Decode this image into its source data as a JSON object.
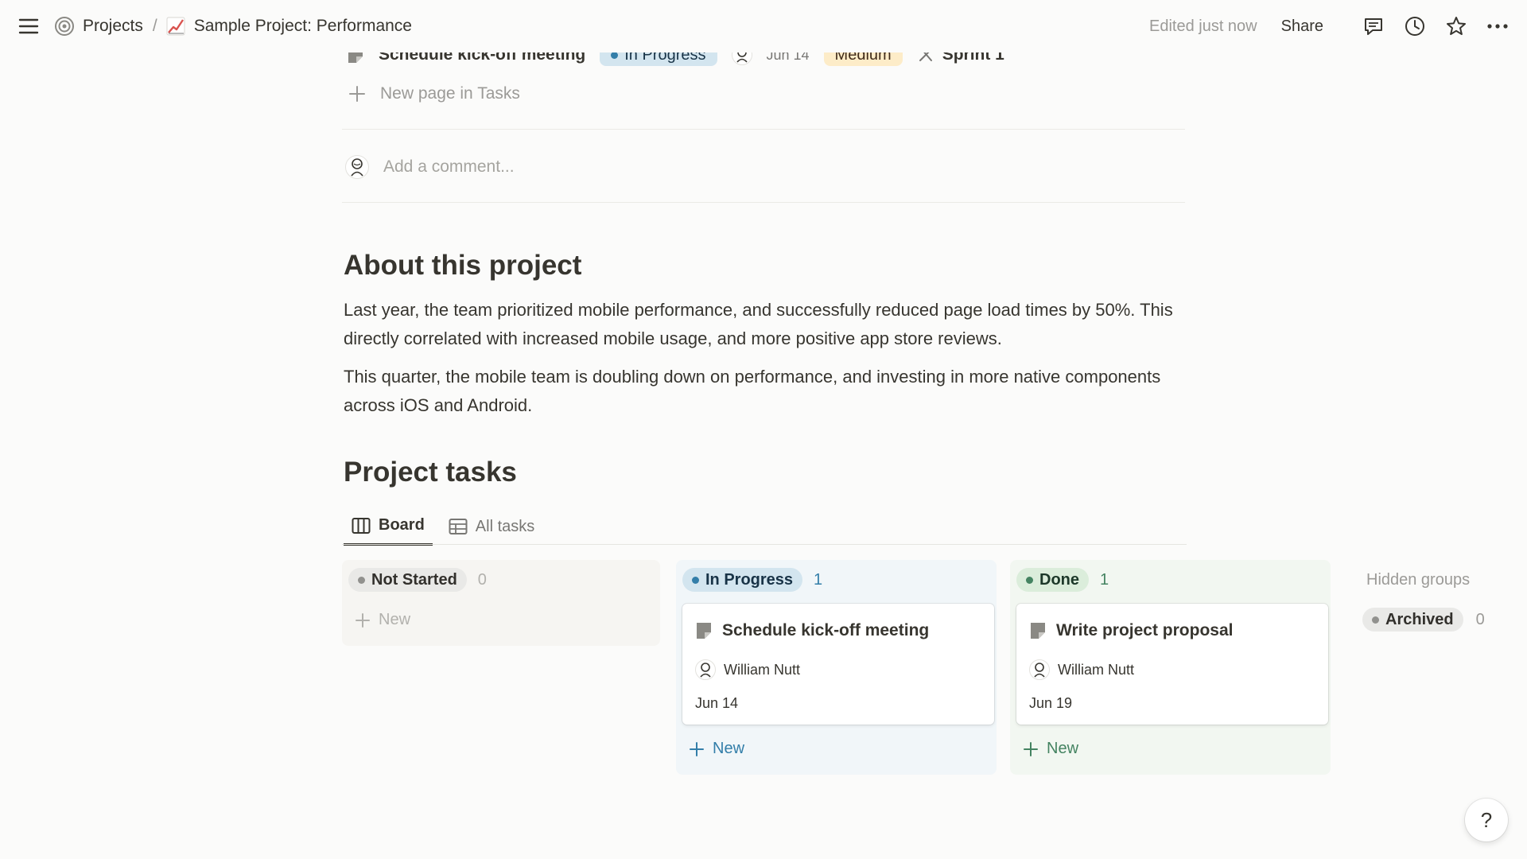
{
  "topbar": {
    "breadcrumb": [
      {
        "label": "Projects",
        "icon": "target-icon"
      },
      {
        "label": "Sample Project: Performance",
        "icon": "chart-increasing-icon"
      }
    ],
    "separator": "/",
    "edited": "Edited just now",
    "share": "Share"
  },
  "partial_row": {
    "title": "Schedule kick-off meeting",
    "status": "In Progress",
    "date": "Jun 14",
    "priority": "Medium",
    "sprint": "Sprint 1"
  },
  "new_page": "New page in Tasks",
  "comment": {
    "placeholder": "Add a comment..."
  },
  "about": {
    "heading": "About this project",
    "p1": "Last year, the team prioritized mobile performance, and successfully reduced page load times by 50%. This directly correlated with increased mobile usage, and more positive app store reviews.",
    "p2": "This quarter, the mobile team is doubling down on performance, and investing in more native components across iOS and Android."
  },
  "tasks": {
    "heading": "Project tasks",
    "tabs": [
      {
        "label": "Board",
        "icon": "board-icon",
        "active": true
      },
      {
        "label": "All tasks",
        "icon": "table-icon",
        "active": false
      }
    ]
  },
  "board": {
    "columns": [
      {
        "name": "Not Started",
        "count": "0",
        "new_label": "New",
        "cards": []
      },
      {
        "name": "In Progress",
        "count": "1",
        "new_label": "New",
        "cards": [
          {
            "title": "Schedule kick-off meeting",
            "assignee": "William Nutt",
            "date": "Jun 14"
          }
        ]
      },
      {
        "name": "Done",
        "count": "1",
        "new_label": "New",
        "cards": [
          {
            "title": "Write project proposal",
            "assignee": "William Nutt",
            "date": "Jun 19"
          }
        ]
      }
    ],
    "hidden_groups": "Hidden groups",
    "archived": {
      "name": "Archived",
      "count": "0"
    }
  },
  "help": "?",
  "colors": {
    "in_progress_bg": "#d3e5ef",
    "in_progress_dot": "#337ea9",
    "done_bg": "#dbeddb",
    "done_dot": "#448361",
    "not_started_bg": "#e9e9e7",
    "gray_dot": "#91918e",
    "medium_bg": "#fdecc8"
  }
}
